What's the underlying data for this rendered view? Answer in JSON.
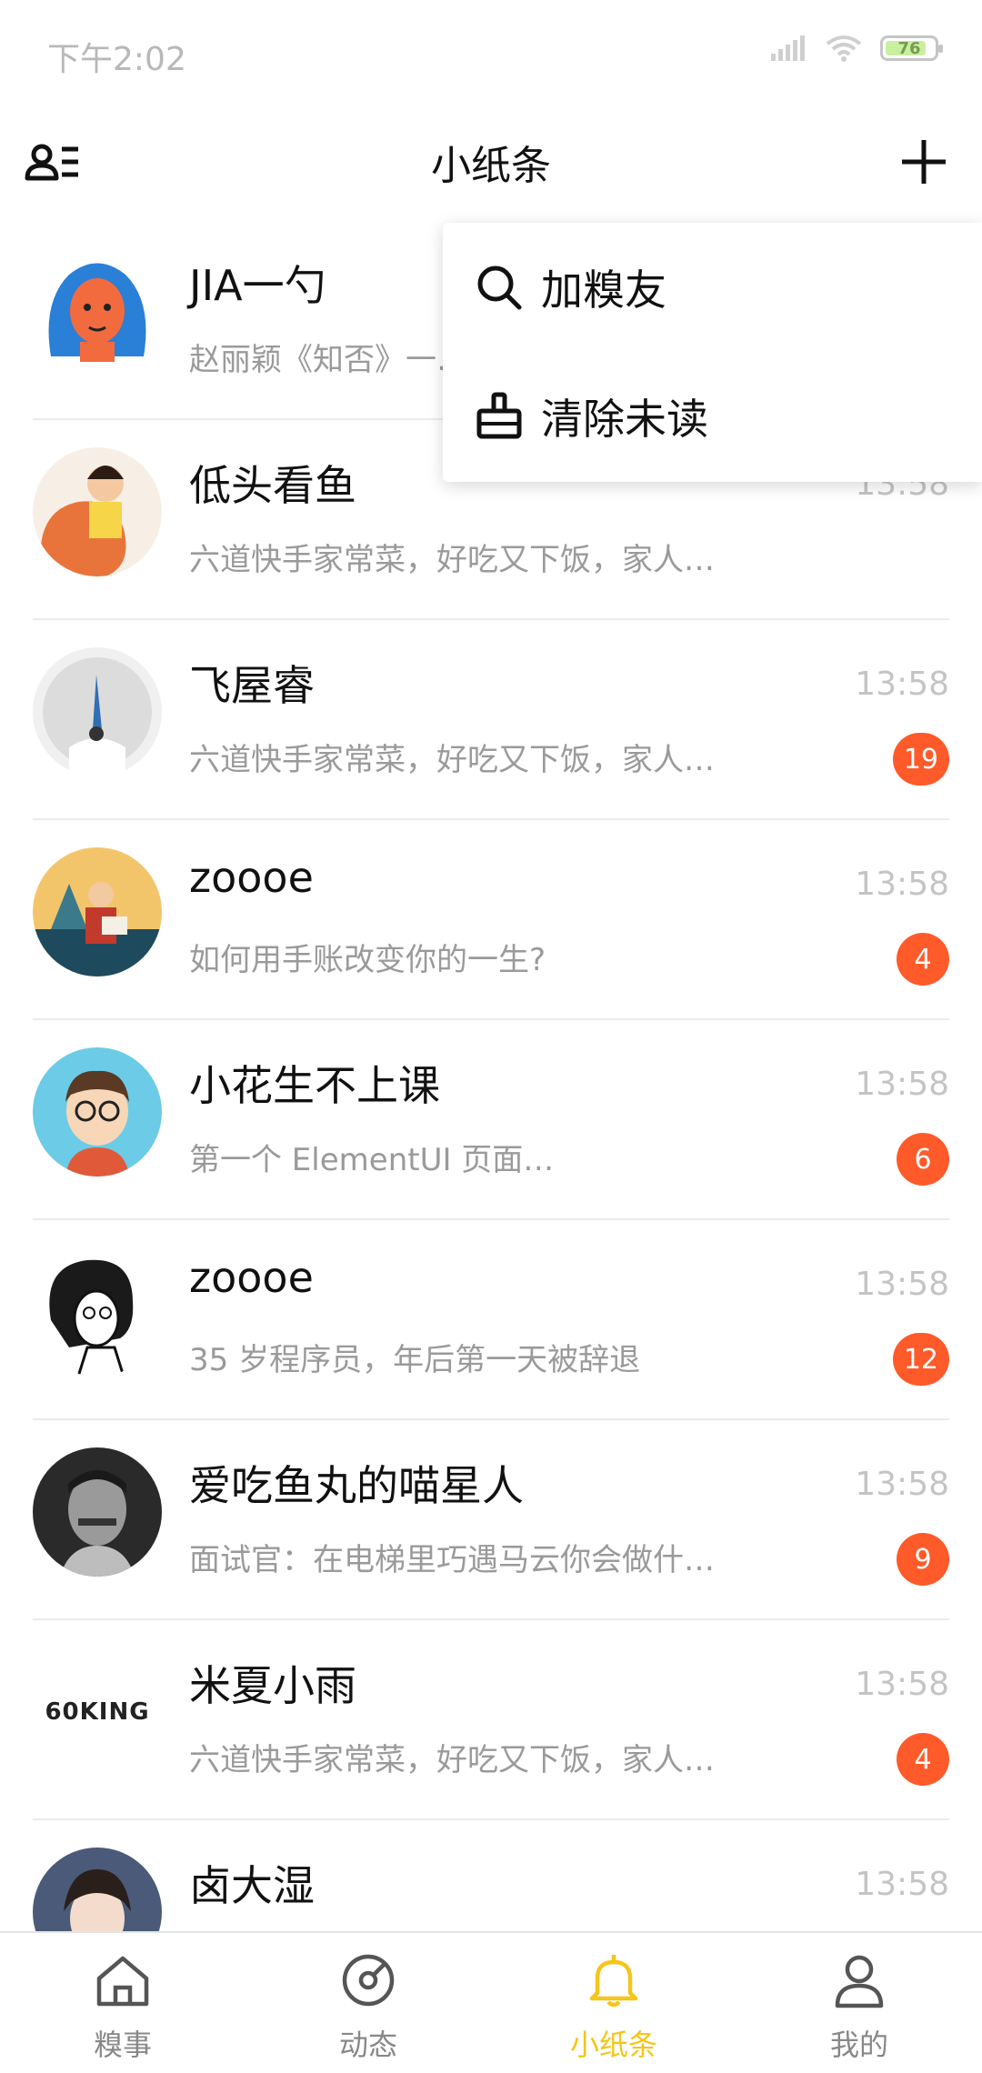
{
  "status_bar": {
    "time": "下午2:02",
    "battery": "76"
  },
  "header": {
    "title": "小纸条"
  },
  "popup_menu": {
    "items": [
      {
        "label": "加糗友",
        "icon": "search-icon"
      },
      {
        "label": "清除未读",
        "icon": "broom-icon"
      }
    ]
  },
  "conversations": [
    {
      "name": "JIA一勺",
      "preview": "赵丽颖《知否》一…",
      "time": "",
      "badge": ""
    },
    {
      "name": "低头看鱼",
      "preview": "六道快手家常菜，好吃又下饭，家人…",
      "time": "13:58",
      "badge": ""
    },
    {
      "name": "飞屋睿",
      "preview": "六道快手家常菜，好吃又下饭，家人…",
      "time": "13:58",
      "badge": "19"
    },
    {
      "name": "zoooe",
      "preview": "如何用手账改变你的一生?",
      "time": "13:58",
      "badge": "4"
    },
    {
      "name": "小花生不上课",
      "preview": "第一个 ElementUI 页面…",
      "time": "13:58",
      "badge": "6"
    },
    {
      "name": "zoooe",
      "preview": "35 岁程序员，年后第一天被辞退",
      "time": "13:58",
      "badge": "12"
    },
    {
      "name": "爱吃鱼丸的喵星人",
      "preview": "面试官：在电梯里巧遇马云你会做什…",
      "time": "13:58",
      "badge": "9"
    },
    {
      "name": "米夏小雨",
      "preview": "六道快手家常菜，好吃又下饭，家人…",
      "time": "13:58",
      "badge": "4",
      "avatar_text": "60KING"
    },
    {
      "name": "卤大湿",
      "preview": "",
      "time": "13:58",
      "badge": ""
    }
  ],
  "tab_bar": {
    "items": [
      {
        "label": "糗事",
        "icon": "home-icon"
      },
      {
        "label": "动态",
        "icon": "compass-icon"
      },
      {
        "label": "小纸条",
        "icon": "bell-icon",
        "active": true
      },
      {
        "label": "我的",
        "icon": "profile-icon"
      }
    ]
  },
  "colors": {
    "accent": "#f5c518",
    "badge": "#ff5a2a"
  }
}
